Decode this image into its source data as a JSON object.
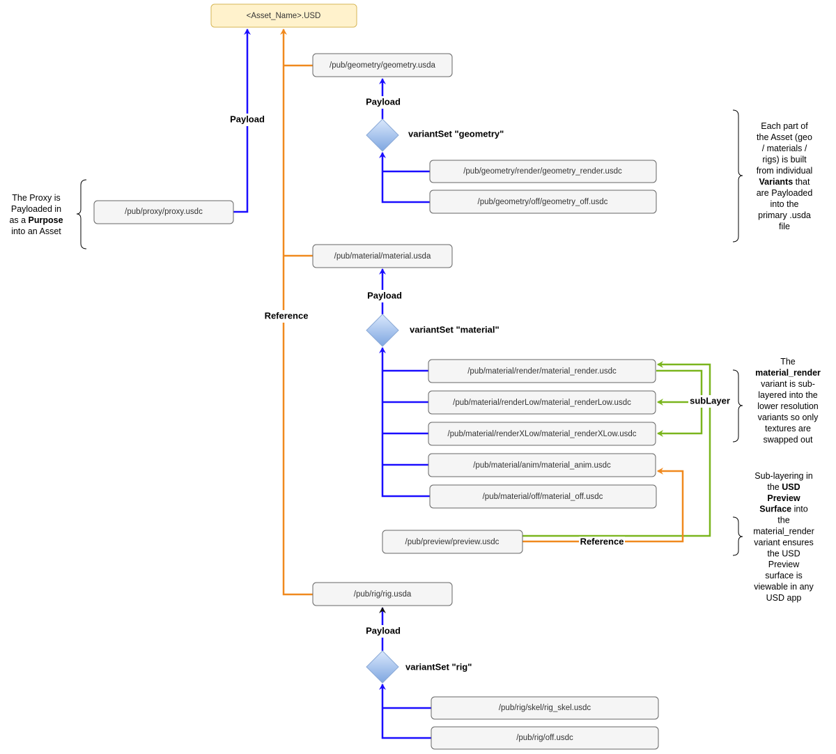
{
  "root": "<Asset_Name>.USD",
  "files": {
    "geometry": "/pub/geometry/geometry.usda",
    "geometry_render": "/pub/geometry/render/geometry_render.usdc",
    "geometry_off": "/pub/geometry/off/geometry_off.usdc",
    "proxy": "/pub/proxy/proxy.usdc",
    "material": "/pub/material/material.usda",
    "material_render": "/pub/material/render/material_render.usdc",
    "material_renderLow": "/pub/material/renderLow/material_renderLow.usdc",
    "material_renderXLow": "/pub/material/renderXLow/material_renderXLow.usdc",
    "material_anim": "/pub/material/anim/material_anim.usdc",
    "material_off": "/pub/material/off/material_off.usdc",
    "preview": "/pub/preview/preview.usdc",
    "rig": "/pub/rig/rig.usda",
    "rig_skel": "/pub/rig/skel/rig_skel.usdc",
    "rig_off": "/pub/rig/off.usdc"
  },
  "labels": {
    "payload": "Payload",
    "reference": "Reference",
    "sublayer": "subLayer",
    "vs_geometry": "variantSet \"geometry\"",
    "vs_material": "variantSet \"material\"",
    "vs_rig": "variantSet \"rig\""
  },
  "notes": {
    "proxy": [
      [
        "The Proxy is"
      ],
      [
        "Payloaded in"
      ],
      [
        "as a ",
        "Purpose"
      ],
      [
        "into an Asset"
      ]
    ],
    "variants": [
      [
        "Each part of"
      ],
      [
        "the Asset (geo"
      ],
      [
        "/ materials /"
      ],
      [
        "rigs) is built"
      ],
      [
        "from individual"
      ],
      [
        "",
        "Variants",
        " that"
      ],
      [
        "are Payloaded"
      ],
      [
        "into the"
      ],
      [
        "primary .usda"
      ],
      [
        "file"
      ]
    ],
    "material_render": [
      [
        "The"
      ],
      [
        "",
        "material_render"
      ],
      [
        "variant is sub-"
      ],
      [
        "layered into the"
      ],
      [
        "lower resolution"
      ],
      [
        "variants so only"
      ],
      [
        "textures are"
      ],
      [
        "swapped out"
      ]
    ],
    "preview": [
      [
        "Sub-layering in"
      ],
      [
        "the ",
        "USD"
      ],
      [
        "",
        "Preview"
      ],
      [
        "",
        "Surface",
        " into"
      ],
      [
        "the"
      ],
      [
        "material_render"
      ],
      [
        "variant ensures"
      ],
      [
        "the USD"
      ],
      [
        "Preview"
      ],
      [
        "surface is"
      ],
      [
        "viewable in any"
      ],
      [
        "USD app"
      ]
    ]
  },
  "colors": {
    "payload": "#1a0dff",
    "reference": "#f0891e",
    "sublayer": "#7ab51d",
    "root_fill": "#fff2cc",
    "diamond": "#a9c4eb"
  }
}
